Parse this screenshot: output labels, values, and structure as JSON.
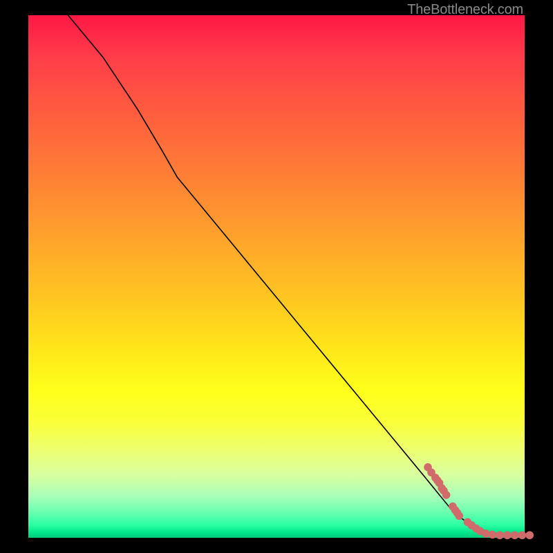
{
  "watermark": "TheBottleneck.com",
  "chart_data": {
    "type": "line",
    "title": "",
    "xlabel": "",
    "ylabel": "",
    "xlim": [
      0,
      100
    ],
    "ylim": [
      0,
      100
    ],
    "series": [
      {
        "name": "curve",
        "x": [
          8,
          15,
          22,
          27,
          30,
          40,
          50,
          60,
          70,
          80,
          86,
          90,
          93,
          96,
          100
        ],
        "y": [
          100,
          92,
          82,
          74,
          69,
          57.5,
          46,
          34.5,
          23,
          11.5,
          4.5,
          2,
          1,
          0.5,
          0.5
        ]
      }
    ],
    "scatter": {
      "name": "dots",
      "points": [
        [
          80.5,
          13.5
        ],
        [
          81.2,
          12.5
        ],
        [
          82.0,
          11.5
        ],
        [
          82.4,
          11.0
        ],
        [
          82.8,
          10.5
        ],
        [
          83.3,
          9.5
        ],
        [
          83.7,
          9.0
        ],
        [
          84.2,
          8.2
        ],
        [
          85.5,
          6.0
        ],
        [
          86.0,
          5.3
        ],
        [
          86.4,
          4.8
        ],
        [
          86.8,
          4.2
        ],
        [
          88.5,
          3.0
        ],
        [
          89.3,
          2.4
        ],
        [
          90.2,
          1.8
        ],
        [
          91.0,
          1.3
        ],
        [
          92.2,
          0.8
        ],
        [
          93.5,
          0.6
        ],
        [
          95.0,
          0.5
        ],
        [
          96.5,
          0.5
        ],
        [
          98.0,
          0.5
        ],
        [
          99.5,
          0.5
        ],
        [
          101.0,
          0.5
        ]
      ],
      "color": "#d16a6a"
    }
  }
}
